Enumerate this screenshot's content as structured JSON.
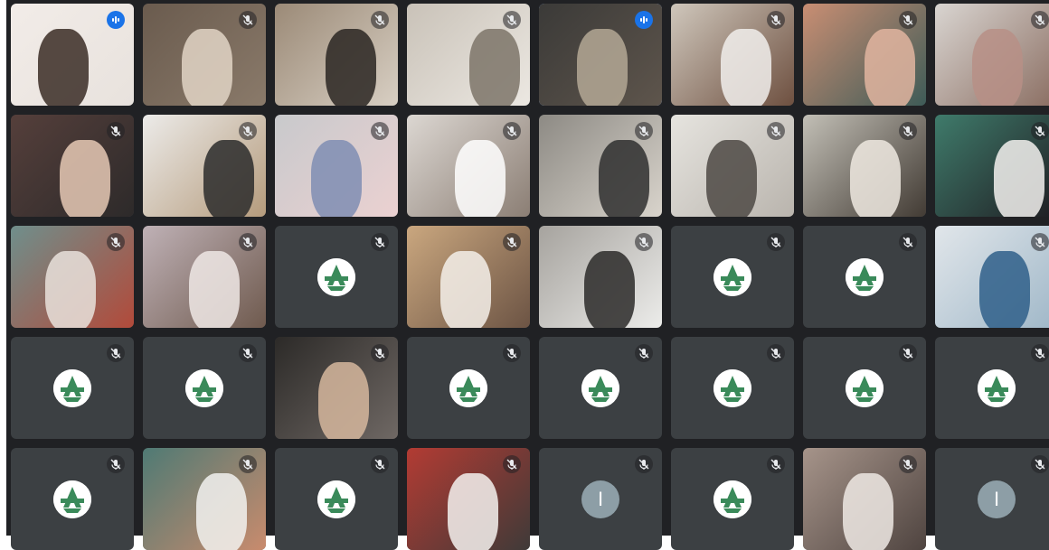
{
  "meeting": {
    "columns": 8,
    "rows": 5,
    "colors": {
      "tile_bg": "#3c4043",
      "grid_bg": "#202124",
      "avatar_letter_bg": "#8d9ea6",
      "logo_green": "#3a8a5a",
      "speaking_blue": "#1a73e8",
      "active_outline": "#8ab4f8"
    }
  },
  "tiles": [
    {
      "kind": "video",
      "mic": "speaking",
      "scene": [
        "#f2ece8",
        "#3a2b25",
        "#e8e2dd"
      ]
    },
    {
      "kind": "video",
      "mic": "muted",
      "scene": [
        "#6a5b4e",
        "#e2d5c6",
        "#8a7a6a"
      ]
    },
    {
      "kind": "video",
      "mic": "muted",
      "scene": [
        "#9b8a77",
        "#2a2622",
        "#d8cfc3"
      ]
    },
    {
      "kind": "video",
      "mic": "muted",
      "scene": [
        "#c9c2b8",
        "#7d7468",
        "#ece8e2"
      ]
    },
    {
      "kind": "video",
      "mic": "speaking",
      "active": true,
      "scene": [
        "#3b3a38",
        "#b4a895",
        "#5e554c"
      ]
    },
    {
      "kind": "video",
      "mic": "muted",
      "scene": [
        "#cfc7bc",
        "#f1efec",
        "#6e5040"
      ]
    },
    {
      "kind": "video",
      "mic": "muted",
      "scene": [
        "#c98e73",
        "#e2b5a0",
        "#3e5b57"
      ]
    },
    {
      "kind": "video",
      "mic": "muted",
      "scene": [
        "#d9d5d1",
        "#b78f86",
        "#8a6d61"
      ]
    },
    {
      "kind": "video",
      "mic": "muted",
      "scene": [
        "#553f3b",
        "#e6c9b5",
        "#2d2a2a"
      ]
    },
    {
      "kind": "video",
      "mic": "muted",
      "scene": [
        "#ecebe9",
        "#2b2b2b",
        "#b59b7c"
      ]
    },
    {
      "kind": "video",
      "mic": "muted",
      "scene": [
        "#c8c9cc",
        "#7f8db3",
        "#ebd1d1"
      ]
    },
    {
      "kind": "video",
      "mic": "muted",
      "scene": [
        "#dcd7d2",
        "#ffffff",
        "#8b7e74"
      ]
    },
    {
      "kind": "video",
      "mic": "muted",
      "scene": [
        "#8d8a84",
        "#2f2f2f",
        "#d9d4cc"
      ]
    },
    {
      "kind": "video",
      "mic": "muted",
      "scene": [
        "#e6e4df",
        "#4d4944",
        "#b9b4ad"
      ]
    },
    {
      "kind": "video",
      "mic": "muted",
      "scene": [
        "#c2bfb6",
        "#efe9e0",
        "#423b34"
      ]
    },
    {
      "kind": "video",
      "mic": "muted",
      "scene": [
        "#3f7b6b",
        "#f3f1ee",
        "#1f1d22"
      ]
    },
    {
      "kind": "video",
      "mic": "muted",
      "scene": [
        "#6f8f8c",
        "#e9e2dc",
        "#b24a3a"
      ]
    },
    {
      "kind": "video",
      "mic": "muted",
      "scene": [
        "#bfb1b6",
        "#efe7e5",
        "#6f5a4e"
      ]
    },
    {
      "kind": "logo",
      "mic": "muted"
    },
    {
      "kind": "video",
      "mic": "muted",
      "scene": [
        "#caa77f",
        "#f4f0ea",
        "#6c5444"
      ]
    },
    {
      "kind": "video",
      "mic": "muted",
      "scene": [
        "#a6a39e",
        "#2b2a29",
        "#ececea"
      ]
    },
    {
      "kind": "logo",
      "mic": "muted"
    },
    {
      "kind": "logo",
      "mic": "muted"
    },
    {
      "kind": "video",
      "mic": "muted",
      "scene": [
        "#e1e6ea",
        "#2f5f8a",
        "#9fb7c8"
      ]
    },
    {
      "kind": "logo",
      "mic": "muted"
    },
    {
      "kind": "logo",
      "mic": "muted"
    },
    {
      "kind": "video",
      "mic": "muted",
      "scene": [
        "#2c2a28",
        "#d6b79d",
        "#6f6864"
      ]
    },
    {
      "kind": "logo",
      "mic": "muted"
    },
    {
      "kind": "logo",
      "mic": "muted"
    },
    {
      "kind": "logo",
      "mic": "muted"
    },
    {
      "kind": "logo",
      "mic": "muted"
    },
    {
      "kind": "logo",
      "mic": "muted"
    },
    {
      "kind": "logo",
      "mic": "muted"
    },
    {
      "kind": "video",
      "mic": "muted",
      "scene": [
        "#4f7a74",
        "#f2f2f0",
        "#c98b6d"
      ]
    },
    {
      "kind": "logo",
      "mic": "muted"
    },
    {
      "kind": "video",
      "mic": "muted",
      "scene": [
        "#b33b33",
        "#f4f2ef",
        "#3f3a38"
      ]
    },
    {
      "kind": "letter",
      "letter": "I",
      "mic": "muted"
    },
    {
      "kind": "logo",
      "mic": "muted"
    },
    {
      "kind": "video",
      "mic": "muted",
      "scene": [
        "#a6948a",
        "#efe9e4",
        "#4f4440"
      ]
    },
    {
      "kind": "letter",
      "letter": "I",
      "mic": "muted"
    }
  ]
}
